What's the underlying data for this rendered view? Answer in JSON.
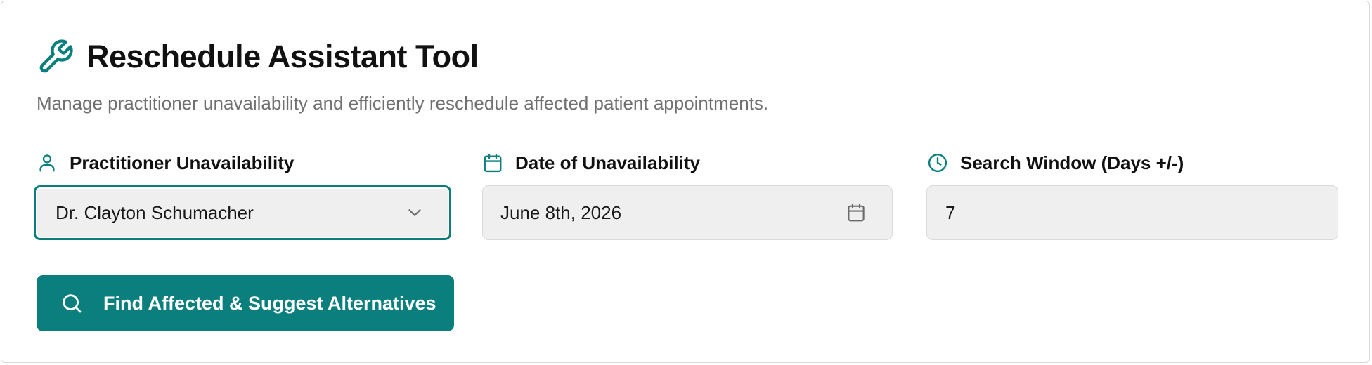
{
  "header": {
    "title": "Reschedule Assistant Tool",
    "title_icon": "wrench-icon",
    "subtitle": "Manage practitioner unavailability and efficiently reschedule affected patient appointments."
  },
  "fields": {
    "practitioner": {
      "label": "Practitioner Unavailability",
      "icon": "user-icon",
      "value": "Dr. Clayton Schumacher",
      "control_icon": "chevron-down-icon"
    },
    "date": {
      "label": "Date of Unavailability",
      "icon": "calendar-icon",
      "value": "June 8th, 2026",
      "control_icon": "calendar-icon"
    },
    "window": {
      "label": "Search Window (Days +/-)",
      "icon": "clock-icon",
      "value": "7"
    }
  },
  "actions": {
    "find_button_label": "Find Affected & Suggest Alternatives",
    "find_button_icon": "search-icon"
  },
  "colors": {
    "accent": "#0b7f7e",
    "text": "#111111",
    "muted": "#707070",
    "input_bg": "#efefef"
  }
}
